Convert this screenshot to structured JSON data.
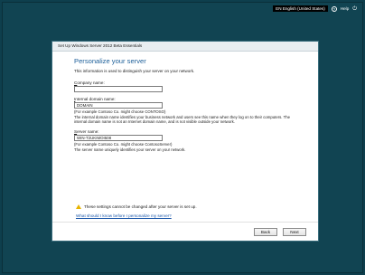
{
  "topbar": {
    "language": "EN English (United States)",
    "help_label": "Help",
    "help_icon": "question-circle-icon",
    "power_icon": "power-icon"
  },
  "dialog": {
    "title": "Set Up Windows Server 2012 Beta Essentials",
    "heading": "Personalize your server",
    "intro": "This information is used to distinguish your server on your network.",
    "fields": {
      "company": {
        "label_prefix": "C",
        "label_rest": "ompany name:",
        "value": ""
      },
      "domain": {
        "label_prefix": "I",
        "label_rest": "nternal domain name:",
        "value": "DOMAIN",
        "example": "(For example Contoso Co. might choose CONTOSO)",
        "help": "The internal domain name identifies your business network and users see this name when they log on to their computers. The internal domain name is not an Internet domain name, and is not visible outside your network."
      },
      "server": {
        "label_prefix": "S",
        "label_rest": "erver name:",
        "value": "WIN-T2UKIMOI508",
        "example": "(For example Contoso Co. might choose ContosoServer)",
        "help": "The server name uniquely identifies your server on your network."
      }
    },
    "warning": "These settings cannot be changed after your server is set up.",
    "link": "What should I know before I personalize my server?",
    "buttons": {
      "back": "Back",
      "next": "Next"
    }
  },
  "colors": {
    "desktop": "#114452",
    "heading": "#1d5f99",
    "link": "#1a56a8",
    "warning": "#e8b400"
  }
}
